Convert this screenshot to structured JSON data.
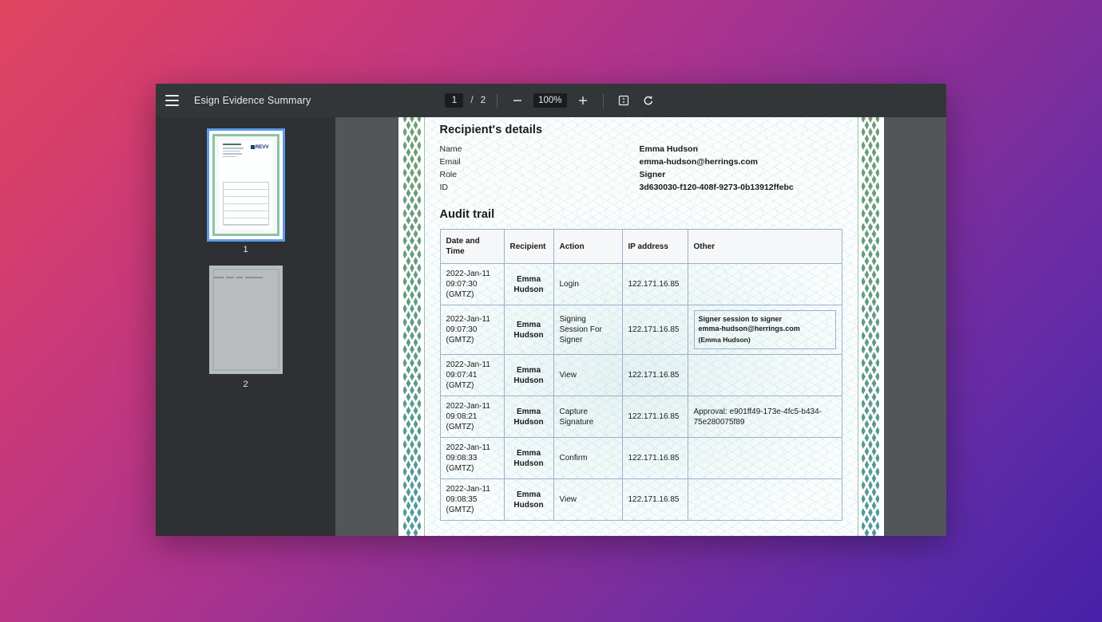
{
  "window": {
    "toolbar": {
      "menu_icon": "hamburger-menu-icon",
      "title": "Esign Evidence Summary",
      "current_page": "1",
      "page_separator": "/",
      "total_pages": "2",
      "zoom_out_label": "−",
      "zoom_level": "100%",
      "zoom_in_label": "+",
      "fit_icon": "fit-to-page-icon",
      "rotate_icon": "rotate-counterclockwise-icon"
    }
  },
  "sidebar": {
    "thumbnails": [
      {
        "label": "1",
        "selected": true,
        "brand": "REVV"
      },
      {
        "label": "2",
        "selected": false,
        "brand": ""
      }
    ]
  },
  "document": {
    "recipient_section": {
      "title": "Recipient's details",
      "rows": [
        {
          "label": "Name",
          "value": "Emma Hudson"
        },
        {
          "label": "Email",
          "value": "emma-hudson@herrings.com"
        },
        {
          "label": "Role",
          "value": "Signer"
        },
        {
          "label": "ID",
          "value": "3d630030-f120-408f-9273-0b13912ffebc"
        }
      ]
    },
    "audit_section": {
      "title": "Audit trail",
      "columns": [
        "Date and Time",
        "Recipient",
        "Action",
        "IP address",
        "Other"
      ],
      "rows": [
        {
          "date": "2022-Jan-11 09:07:30 (GMTZ)",
          "recipient": "Emma Hudson",
          "action": "Login",
          "ip": "122.171.16.85",
          "other_type": "none",
          "other": ""
        },
        {
          "date": "2022-Jan-11 09:07:30 (GMTZ)",
          "recipient": "Emma Hudson",
          "action": "Signing Session For Signer",
          "ip": "122.171.16.85",
          "other_type": "box",
          "other_title": "Signer session  to signer",
          "other_email": "emma-hudson@herrings.com",
          "other_name": "(Emma Hudson)"
        },
        {
          "date": "2022-Jan-11 09:07:41 (GMTZ)",
          "recipient": "Emma Hudson",
          "action": "View",
          "ip": "122.171.16.85",
          "other_type": "none",
          "other": ""
        },
        {
          "date": "2022-Jan-11 09:08:21 (GMTZ)",
          "recipient": "Emma Hudson",
          "action": "Capture Signature",
          "ip": "122.171.16.85",
          "other_type": "text",
          "other": "Approval: e901ff49-173e-4fc5-b434-75e280075f89"
        },
        {
          "date": "2022-Jan-11 09:08:33 (GMTZ)",
          "recipient": "Emma Hudson",
          "action": "Confirm",
          "ip": "122.171.16.85",
          "other_type": "none",
          "other": ""
        },
        {
          "date": "2022-Jan-11 09:08:35 (GMTZ)",
          "recipient": "Emma Hudson",
          "action": "View",
          "ip": "122.171.16.85",
          "other_type": "none",
          "other": ""
        }
      ]
    }
  },
  "colors": {
    "toolbar_bg": "#323639",
    "sidebar_bg": "#2e3033",
    "viewport_bg": "#525659",
    "selection_blue": "#5b9bea",
    "certificate_green": "#6f9f76",
    "certificate_teal": "#4e9a9b",
    "table_border": "#9ab1cc"
  }
}
